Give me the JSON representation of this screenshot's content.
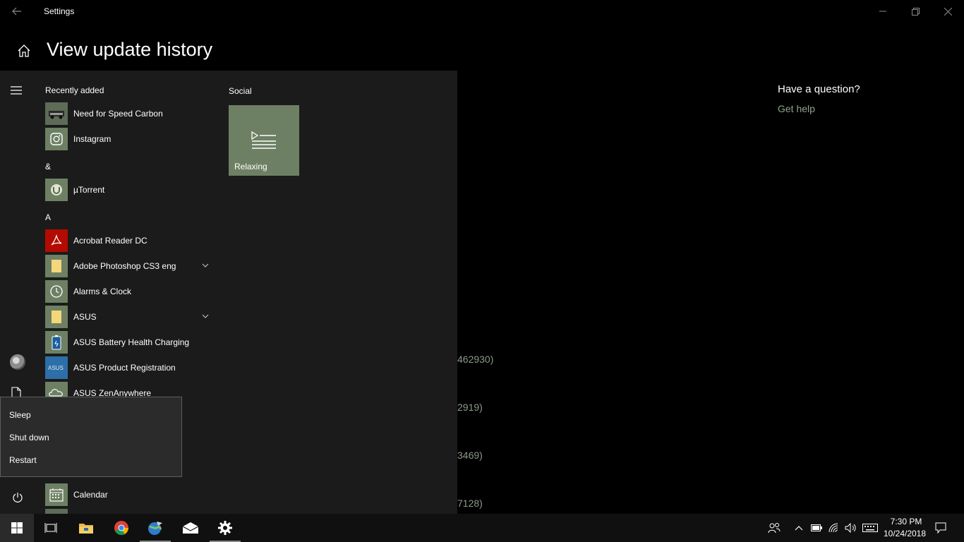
{
  "window": {
    "app_title": "Settings",
    "page_title": "View update history",
    "side_panel": {
      "heading": "Have a question?",
      "link": "Get help"
    },
    "history_fragments": [
      "462930)",
      "2919)",
      "3469)",
      "7128)"
    ]
  },
  "start_menu": {
    "groups": [
      {
        "header": "Recently added",
        "items": [
          {
            "label": "Need for Speed Carbon",
            "icon": "nfs-icon"
          },
          {
            "label": "Instagram",
            "icon": "instagram-icon"
          }
        ]
      },
      {
        "header": "&",
        "items": [
          {
            "label": "µTorrent",
            "icon": "utorrent-icon"
          }
        ]
      },
      {
        "header": "A",
        "items": [
          {
            "label": "Acrobat Reader DC",
            "icon": "acrobat-icon"
          },
          {
            "label": "Adobe Photoshop CS3 eng",
            "icon": "folder-icon",
            "expandable": true
          },
          {
            "label": "Alarms & Clock",
            "icon": "clock-icon"
          },
          {
            "label": "ASUS",
            "icon": "folder-icon",
            "expandable": true
          },
          {
            "label": "ASUS Battery Health Charging",
            "icon": "battery-icon"
          },
          {
            "label": "ASUS Product Registration",
            "icon": "asus-icon"
          },
          {
            "label": "ASUS ZenAnywhere",
            "icon": "zenanywhere-icon"
          }
        ]
      },
      {
        "header": "",
        "items": [
          {
            "label": "Calendar",
            "icon": "calendar-icon"
          }
        ]
      }
    ],
    "tile_group": {
      "header": "Social",
      "tiles": [
        {
          "label": "Relaxing",
          "icon": "playlist-icon"
        }
      ]
    },
    "power_menu": [
      "Sleep",
      "Shut down",
      "Restart"
    ]
  },
  "taskbar": {
    "clock": {
      "time": "7:30 PM",
      "date": "10/24/2018"
    }
  },
  "colors": {
    "start_bg": "#1b1b1b",
    "tile_accent": "#6d8063",
    "link_green": "#8fa48d",
    "taskbar_bg": "#101010"
  }
}
